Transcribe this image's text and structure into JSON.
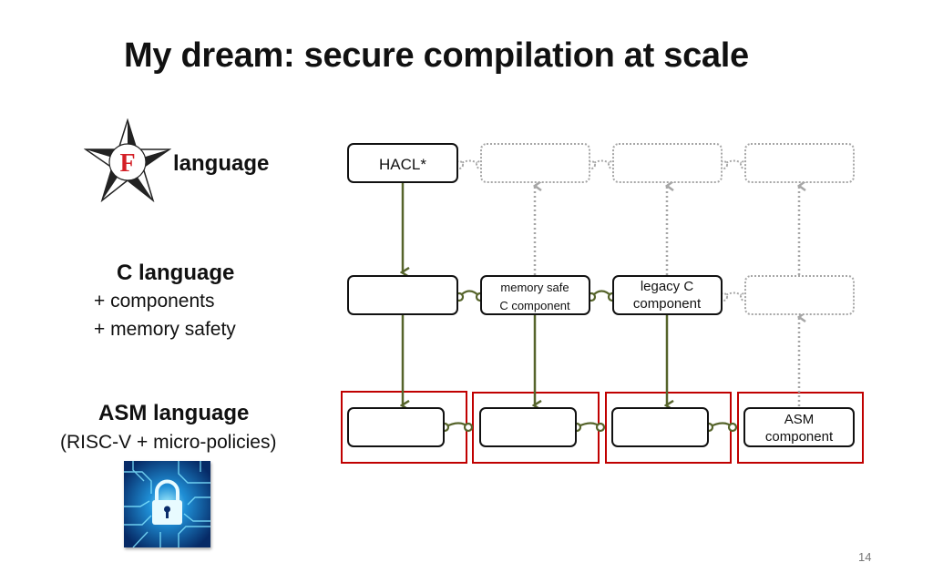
{
  "slide": {
    "title": "My dream: secure compilation at scale",
    "page_number": "14"
  },
  "levels": {
    "fstar": {
      "logo_letter": "F",
      "label": "language"
    },
    "c": {
      "title": "C language",
      "features": [
        "+ components",
        "+ memory safety"
      ]
    },
    "asm": {
      "title": "ASM language",
      "subtitle": "(RISC-V + micro-policies)"
    }
  },
  "diagram": {
    "top_row": [
      {
        "label": "HACL*",
        "style": "solid"
      },
      {
        "label": "",
        "style": "dotted"
      },
      {
        "label": "",
        "style": "dotted"
      },
      {
        "label": "",
        "style": "dotted"
      }
    ],
    "middle_row": [
      {
        "label_lines": [],
        "style": "solid"
      },
      {
        "label_lines": [
          "memory safe",
          "C component"
        ],
        "style": "solid"
      },
      {
        "label_lines": [
          "legacy C",
          "component"
        ],
        "style": "solid"
      },
      {
        "label_lines": [],
        "style": "dotted"
      }
    ],
    "bottom_row": [
      {
        "label_lines": [],
        "style": "solid"
      },
      {
        "label_lines": [],
        "style": "solid"
      },
      {
        "label_lines": [],
        "style": "solid"
      },
      {
        "label_lines": [
          "ASM",
          "component"
        ],
        "style": "solid"
      }
    ],
    "colors": {
      "box_border": "#111111",
      "dotted": "#a6a6a6",
      "arrow": "#56642b",
      "protection": "#c00000"
    }
  }
}
